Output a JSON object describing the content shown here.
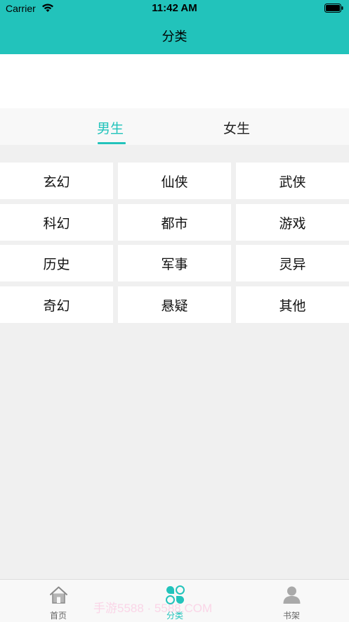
{
  "status_bar": {
    "carrier": "Carrier",
    "time": "11:42 AM"
  },
  "nav": {
    "title": "分类"
  },
  "tabs": [
    {
      "label": "男生",
      "active": true
    },
    {
      "label": "女生",
      "active": false
    }
  ],
  "categories": [
    [
      "玄幻",
      "仙侠",
      "武侠"
    ],
    [
      "科幻",
      "都市",
      "游戏"
    ],
    [
      "历史",
      "军事",
      "灵异"
    ],
    [
      "奇幻",
      "悬疑",
      "其他"
    ]
  ],
  "tab_bar": [
    {
      "label": "首页",
      "icon": "home-icon",
      "active": false
    },
    {
      "label": "分类",
      "icon": "category-icon",
      "active": true
    },
    {
      "label": "书架",
      "icon": "user-icon",
      "active": false
    }
  ],
  "watermark": "手游5588 · 5588.COM",
  "colors": {
    "accent": "#22c3bb",
    "background": "#f0f0f0"
  }
}
